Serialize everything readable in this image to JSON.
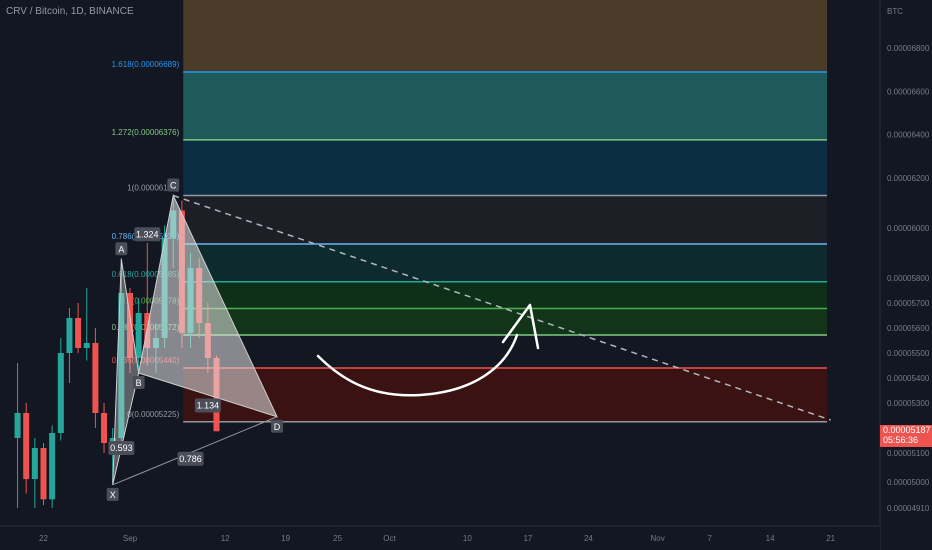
{
  "header": {
    "title": "CRV / Bitcoin, 1D, BINANCE"
  },
  "price_axis": {
    "unit_label": "BTC",
    "ticks": [
      {
        "label": "0.00006800",
        "value": 6800
      },
      {
        "label": "0.00006600",
        "value": 6600
      },
      {
        "label": "0.00006400",
        "value": 6400
      },
      {
        "label": "0.00006200",
        "value": 6200
      },
      {
        "label": "0.00006000",
        "value": 6000
      },
      {
        "label": "0.00005800",
        "value": 5800
      },
      {
        "label": "0.00005700",
        "value": 5700
      },
      {
        "label": "0.00005600",
        "value": 5600
      },
      {
        "label": "0.00005500",
        "value": 5500
      },
      {
        "label": "0.00005400",
        "value": 5400
      },
      {
        "label": "0.00005300",
        "value": 5300
      },
      {
        "label": "0.00005100",
        "value": 5100
      },
      {
        "label": "0.00005000",
        "value": 5000
      },
      {
        "label": "0.00004910",
        "value": 4910
      }
    ],
    "current_price": "0.00005187",
    "countdown": "05:56:36",
    "current_color": "#ef5350"
  },
  "time_axis": {
    "ticks": [
      {
        "label": "22",
        "day": -10
      },
      {
        "label": "Sep",
        "day": 0
      },
      {
        "label": "12",
        "day": 11
      },
      {
        "label": "19",
        "day": 18
      },
      {
        "label": "25",
        "day": 24
      },
      {
        "label": "Oct",
        "day": 30
      },
      {
        "label": "10",
        "day": 39
      },
      {
        "label": "17",
        "day": 46
      },
      {
        "label": "24",
        "day": 53
      },
      {
        "label": "Nov",
        "day": 61
      },
      {
        "label": "7",
        "day": 67
      },
      {
        "label": "14",
        "day": 74
      },
      {
        "label": "21",
        "day": 81
      }
    ]
  },
  "colors": {
    "up": "#26a69a",
    "down": "#ef5350",
    "background": "#131722",
    "pattern_fill": "#e6e6e6",
    "annotation": "#ffffff"
  },
  "fib_levels": [
    {
      "ratio": "1.618",
      "label": "1.618(0.00006689)",
      "value": 6689,
      "color": "#2196f3",
      "fill": "#1e5a5a"
    },
    {
      "ratio": "1.272",
      "label": "1.272(0.00006376)",
      "value": 6376,
      "color": "#81c784",
      "fill": "#0b2e45"
    },
    {
      "ratio": "1",
      "label": "1(0.00006130)",
      "value": 6130,
      "color": "#9598a1",
      "fill": "#1e1f26"
    },
    {
      "ratio": "0.786",
      "label": "0.786(0.00005936)",
      "value": 5936,
      "color": "#64b5f6",
      "fill": "#0d2a2c"
    },
    {
      "ratio": "0.618",
      "label": "0.618(0.00005785)",
      "value": 5785,
      "color": "#26a69a",
      "fill": "#0e3018"
    },
    {
      "ratio": "0.5",
      "label": "0.5(0.00005678)",
      "value": 5678,
      "color": "#4caf50",
      "fill": "#12351a"
    },
    {
      "ratio": "0.382",
      "label": "0.382(0.00005572)",
      "value": 5572,
      "color": "#81c784",
      "fill": "#131722"
    },
    {
      "ratio": "0.236",
      "label": "0.236(0.00005440)",
      "value": 5440,
      "color": "#ef5350",
      "fill": "#3b1212"
    },
    {
      "ratio": "0",
      "label": "0(0.00005225)",
      "value": 5225,
      "color": "#9598a1",
      "fill": ""
    }
  ],
  "fib_top_fill": "#4a3c28",
  "harmonic": {
    "points": [
      {
        "label": "X",
        "day": -2,
        "value": 4990
      },
      {
        "label": "A",
        "day": -1,
        "value": 5875
      },
      {
        "label": "B",
        "day": 1,
        "value": 5420
      },
      {
        "label": "C",
        "day": 5,
        "value": 6130
      },
      {
        "label": "D",
        "day": 17,
        "value": 5245
      }
    ],
    "ratios": [
      {
        "label": "0.593",
        "day": -1,
        "value": 5120
      },
      {
        "label": "1.324",
        "day": 2,
        "value": 5975
      },
      {
        "label": "1.134",
        "day": 9,
        "value": 5290
      },
      {
        "label": "0.786",
        "day": 7,
        "value": 5080
      }
    ]
  },
  "projection": {
    "from_day": 5,
    "from_value": 6130,
    "to_day": 81,
    "to_value": 5232
  },
  "chart_data": {
    "type": "candlestick",
    "title": "CRV / Bitcoin, 1D, BINANCE",
    "ylabel": "BTC",
    "ylim": [
      4880,
      6950
    ],
    "xlim_days": [
      -13,
      85
    ],
    "candles": [
      {
        "day": -13,
        "o": 5160,
        "h": 5460,
        "l": 4910,
        "c": 5260
      },
      {
        "day": -12,
        "o": 5260,
        "h": 5300,
        "l": 4960,
        "c": 5010
      },
      {
        "day": -11,
        "o": 5010,
        "h": 5160,
        "l": 4910,
        "c": 5120
      },
      {
        "day": -10,
        "o": 5120,
        "h": 5140,
        "l": 4920,
        "c": 4940
      },
      {
        "day": -9,
        "o": 4940,
        "h": 5210,
        "l": 4910,
        "c": 5180
      },
      {
        "day": -8,
        "o": 5180,
        "h": 5560,
        "l": 5150,
        "c": 5500
      },
      {
        "day": -7,
        "o": 5500,
        "h": 5680,
        "l": 5380,
        "c": 5640
      },
      {
        "day": -6,
        "o": 5640,
        "h": 5700,
        "l": 5500,
        "c": 5520
      },
      {
        "day": -5,
        "o": 5520,
        "h": 5760,
        "l": 5470,
        "c": 5540
      },
      {
        "day": -4,
        "o": 5540,
        "h": 5600,
        "l": 5200,
        "c": 5260
      },
      {
        "day": -3,
        "o": 5260,
        "h": 5300,
        "l": 5100,
        "c": 5140
      },
      {
        "day": -2,
        "o": 5140,
        "h": 5200,
        "l": 4990,
        "c": 5160
      },
      {
        "day": -1,
        "o": 5160,
        "h": 5880,
        "l": 5140,
        "c": 5740
      },
      {
        "day": 0,
        "o": 5740,
        "h": 5760,
        "l": 5420,
        "c": 5480
      },
      {
        "day": 1,
        "o": 5480,
        "h": 5720,
        "l": 5420,
        "c": 5660
      },
      {
        "day": 2,
        "o": 5660,
        "h": 5940,
        "l": 5450,
        "c": 5520
      },
      {
        "day": 3,
        "o": 5520,
        "h": 5620,
        "l": 5420,
        "c": 5560
      },
      {
        "day": 4,
        "o": 5560,
        "h": 6010,
        "l": 5520,
        "c": 5960
      },
      {
        "day": 5,
        "o": 5960,
        "h": 6130,
        "l": 5840,
        "c": 6070
      },
      {
        "day": 6,
        "o": 6070,
        "h": 6110,
        "l": 5520,
        "c": 5580
      },
      {
        "day": 7,
        "o": 5580,
        "h": 5900,
        "l": 5520,
        "c": 5840
      },
      {
        "day": 8,
        "o": 5840,
        "h": 5880,
        "l": 5560,
        "c": 5620
      },
      {
        "day": 9,
        "o": 5620,
        "h": 5700,
        "l": 5420,
        "c": 5480
      },
      {
        "day": 10,
        "o": 5480,
        "h": 5490,
        "l": 5187,
        "c": 5187
      }
    ]
  }
}
